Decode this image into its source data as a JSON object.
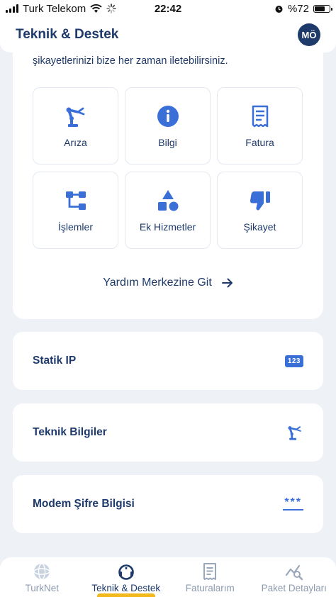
{
  "status_bar": {
    "carrier": "Turk Telekom",
    "time": "22:42",
    "battery": "%72",
    "battery_level": 0.72
  },
  "header": {
    "title": "Teknik & Destek",
    "avatar_initials": "MÖ"
  },
  "support": {
    "text": "şikayetlerinizi bize her zaman iletebilirsiniz.",
    "tiles": [
      {
        "label": "Arıza",
        "icon": "robot-arm-icon"
      },
      {
        "label": "Bilgi",
        "icon": "info-icon"
      },
      {
        "label": "Fatura",
        "icon": "invoice-icon"
      },
      {
        "label": "İşlemler",
        "icon": "flow-icon"
      },
      {
        "label": "Ek Hizmetler",
        "icon": "shapes-icon"
      },
      {
        "label": "Şikayet",
        "icon": "thumbs-down-icon"
      }
    ],
    "help_link": "Yardım Merkezine Git"
  },
  "rows": [
    {
      "label": "Statik IP",
      "badge": "123",
      "icon": "ip-badge-icon"
    },
    {
      "label": "Teknik Bilgiler",
      "icon": "robot-arm-icon"
    },
    {
      "label": "Modem Şifre Bilgisi",
      "badge": "***",
      "icon": "password-icon"
    }
  ],
  "tab_bar": {
    "tabs": [
      {
        "label": "TurkNet",
        "icon": "globe-icon",
        "active": false
      },
      {
        "label": "Teknik & Destek",
        "icon": "headset-icon",
        "active": true
      },
      {
        "label": "Faturalarım",
        "icon": "invoice-icon",
        "active": false
      },
      {
        "label": "Paket Detayları",
        "icon": "chart-search-icon",
        "active": false
      }
    ]
  },
  "colors": {
    "primary": "#1e3a6b",
    "accent": "#3b6fd8",
    "indicator": "#f2b81c",
    "background": "#eef1f6"
  }
}
